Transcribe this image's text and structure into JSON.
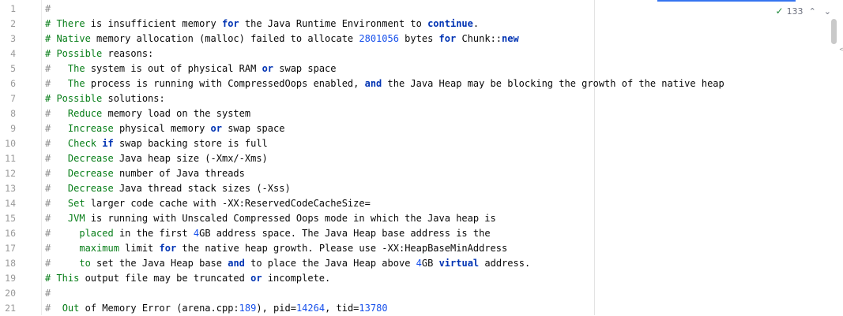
{
  "editor": {
    "inspection_count": "133",
    "inspection_icon": "check-icon",
    "lines": [
      {
        "n": "1",
        "tokens": [
          {
            "t": "#",
            "c": "comment"
          }
        ]
      },
      {
        "n": "2",
        "tokens": [
          {
            "t": "# There ",
            "c": "seg"
          },
          {
            "t": "is insufficient memory ",
            "c": "text"
          },
          {
            "t": "for",
            "c": "kw"
          },
          {
            "t": " the Java Runtime Environment to ",
            "c": "text"
          },
          {
            "t": "continue",
            "c": "kw"
          },
          {
            "t": ".",
            "c": "text"
          }
        ]
      },
      {
        "n": "3",
        "tokens": [
          {
            "t": "# Native ",
            "c": "seg"
          },
          {
            "t": "memory allocation (malloc) failed to allocate ",
            "c": "text"
          },
          {
            "t": "2801056",
            "c": "num"
          },
          {
            "t": " bytes ",
            "c": "text"
          },
          {
            "t": "for",
            "c": "kw"
          },
          {
            "t": " Chunk::",
            "c": "text"
          },
          {
            "t": "new",
            "c": "kw"
          }
        ]
      },
      {
        "n": "4",
        "tokens": [
          {
            "t": "# Possible ",
            "c": "seg"
          },
          {
            "t": "reasons:",
            "c": "text"
          }
        ]
      },
      {
        "n": "5",
        "tokens": [
          {
            "t": "#   ",
            "c": "comment"
          },
          {
            "t": "The ",
            "c": "seg"
          },
          {
            "t": "system is out of physical RAM ",
            "c": "text"
          },
          {
            "t": "or",
            "c": "kw"
          },
          {
            "t": " swap space",
            "c": "text"
          }
        ]
      },
      {
        "n": "6",
        "tokens": [
          {
            "t": "#   ",
            "c": "comment"
          },
          {
            "t": "The ",
            "c": "seg"
          },
          {
            "t": "process is running with CompressedOops enabled, ",
            "c": "text"
          },
          {
            "t": "and",
            "c": "kw"
          },
          {
            "t": " the Java Heap may be blocking the growth of the native heap",
            "c": "text"
          }
        ]
      },
      {
        "n": "7",
        "tokens": [
          {
            "t": "# Possible ",
            "c": "seg"
          },
          {
            "t": "solutions:",
            "c": "text"
          }
        ]
      },
      {
        "n": "8",
        "tokens": [
          {
            "t": "#   ",
            "c": "comment"
          },
          {
            "t": "Reduce ",
            "c": "seg"
          },
          {
            "t": "memory load on the system",
            "c": "text"
          }
        ]
      },
      {
        "n": "9",
        "tokens": [
          {
            "t": "#   ",
            "c": "comment"
          },
          {
            "t": "Increase ",
            "c": "seg"
          },
          {
            "t": "physical memory ",
            "c": "text"
          },
          {
            "t": "or",
            "c": "kw"
          },
          {
            "t": " swap space",
            "c": "text"
          }
        ]
      },
      {
        "n": "10",
        "tokens": [
          {
            "t": "#   ",
            "c": "comment"
          },
          {
            "t": "Check ",
            "c": "seg"
          },
          {
            "t": "if",
            "c": "kw"
          },
          {
            "t": " swap backing store is full",
            "c": "text"
          }
        ]
      },
      {
        "n": "11",
        "tokens": [
          {
            "t": "#   ",
            "c": "comment"
          },
          {
            "t": "Decrease ",
            "c": "seg"
          },
          {
            "t": "Java heap size (-Xmx/-Xms)",
            "c": "text"
          }
        ]
      },
      {
        "n": "12",
        "tokens": [
          {
            "t": "#   ",
            "c": "comment"
          },
          {
            "t": "Decrease ",
            "c": "seg"
          },
          {
            "t": "number of Java threads",
            "c": "text"
          }
        ]
      },
      {
        "n": "13",
        "tokens": [
          {
            "t": "#   ",
            "c": "comment"
          },
          {
            "t": "Decrease ",
            "c": "seg"
          },
          {
            "t": "Java thread stack sizes (-Xss)",
            "c": "text"
          }
        ]
      },
      {
        "n": "14",
        "tokens": [
          {
            "t": "#   ",
            "c": "comment"
          },
          {
            "t": "Set ",
            "c": "seg"
          },
          {
            "t": "larger code cache with -XX:ReservedCodeCacheSize=",
            "c": "text"
          }
        ]
      },
      {
        "n": "15",
        "tokens": [
          {
            "t": "#   ",
            "c": "comment"
          },
          {
            "t": "JVM ",
            "c": "seg"
          },
          {
            "t": "is running with Unscaled Compressed Oops mode in which the Java heap is",
            "c": "text"
          }
        ]
      },
      {
        "n": "16",
        "tokens": [
          {
            "t": "#     ",
            "c": "comment"
          },
          {
            "t": "placed ",
            "c": "seg"
          },
          {
            "t": "in the first ",
            "c": "text"
          },
          {
            "t": "4",
            "c": "num"
          },
          {
            "t": "GB address space. The Java Heap base address is the",
            "c": "text"
          }
        ]
      },
      {
        "n": "17",
        "tokens": [
          {
            "t": "#     ",
            "c": "comment"
          },
          {
            "t": "maximum ",
            "c": "seg"
          },
          {
            "t": "limit ",
            "c": "text"
          },
          {
            "t": "for",
            "c": "kw"
          },
          {
            "t": " the native heap growth. Please use -XX:HeapBaseMinAddress",
            "c": "text"
          }
        ]
      },
      {
        "n": "18",
        "tokens": [
          {
            "t": "#     ",
            "c": "comment"
          },
          {
            "t": "to ",
            "c": "seg"
          },
          {
            "t": "set the Java Heap base ",
            "c": "text"
          },
          {
            "t": "and",
            "c": "kw"
          },
          {
            "t": " to place the Java Heap above ",
            "c": "text"
          },
          {
            "t": "4",
            "c": "num"
          },
          {
            "t": "GB ",
            "c": "text"
          },
          {
            "t": "virtual",
            "c": "kw"
          },
          {
            "t": " address.",
            "c": "text"
          }
        ]
      },
      {
        "n": "19",
        "tokens": [
          {
            "t": "# This ",
            "c": "seg"
          },
          {
            "t": "output file may be truncated ",
            "c": "text"
          },
          {
            "t": "or",
            "c": "kw"
          },
          {
            "t": " incomplete.",
            "c": "text"
          }
        ]
      },
      {
        "n": "20",
        "tokens": [
          {
            "t": "#",
            "c": "comment"
          }
        ]
      },
      {
        "n": "21",
        "tokens": [
          {
            "t": "#  ",
            "c": "comment"
          },
          {
            "t": "Out ",
            "c": "seg"
          },
          {
            "t": "of Memory Error (arena.cpp:",
            "c": "text"
          },
          {
            "t": "189",
            "c": "num"
          },
          {
            "t": "), pid=",
            "c": "text"
          },
          {
            "t": "14264",
            "c": "num"
          },
          {
            "t": ", tid=",
            "c": "text"
          },
          {
            "t": "13780",
            "c": "num"
          }
        ]
      }
    ]
  }
}
